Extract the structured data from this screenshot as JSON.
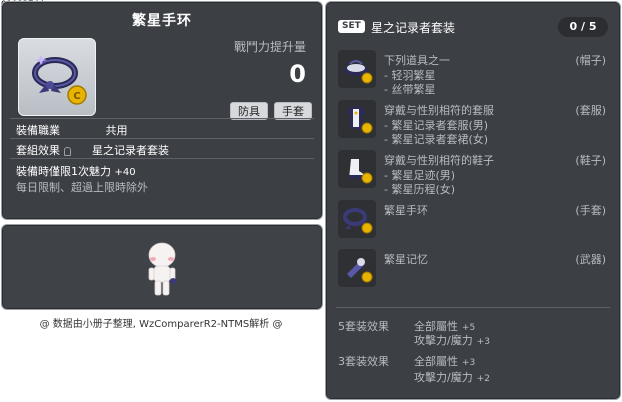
{
  "item_id": "01082744",
  "item": {
    "name": "繁星手环",
    "power_label": "戰鬥力提升量",
    "power_value": "0",
    "tags": [
      "防具",
      "手套"
    ],
    "job_label": "裝備職業",
    "job_value": "共用",
    "set_effect_label": "套組效果",
    "set_effect_value": "星之记录者套装",
    "equip_stat": "裝備時僅限1次魅力",
    "equip_stat_value": "+40",
    "note": "每日限制、超過上限時除外"
  },
  "credit": "@ 数据由小册子整理, WzComparerR2-NTMS解析 @",
  "set": {
    "badge": "SET",
    "name": "星之记录者套装",
    "count": "0 / 5",
    "items": [
      {
        "lines": [
          "下列道具之一",
          "- 轻羽繁星",
          "- 丝带繁星"
        ],
        "category": "(帽子)",
        "icon": "ribbon-hat-icon"
      },
      {
        "lines": [
          "穿戴与性别相符的套服",
          "- 繁星记录者套服(男)",
          "- 繁星记录者套裙(女)"
        ],
        "category": "(套服)",
        "icon": "outfit-icon"
      },
      {
        "lines": [
          "穿戴与性别相符的鞋子",
          "- 繁星足迹(男)",
          "- 繁星历程(女)"
        ],
        "category": "(鞋子)",
        "icon": "shoes-icon"
      },
      {
        "lines": [
          "繁星手环"
        ],
        "category": "(手套)",
        "icon": "bracelet-icon"
      },
      {
        "lines": [
          "繁星记忆"
        ],
        "category": "(武器)",
        "icon": "weapon-icon"
      }
    ],
    "bonuses": [
      {
        "title": "5套装效果",
        "stats": [
          {
            "label": "全部屬性",
            "value": "+5"
          },
          {
            "label": "攻擊力/魔力",
            "value": "+3"
          }
        ]
      },
      {
        "title": "3套装效果",
        "stats": [
          {
            "label": "全部屬性",
            "value": "+3"
          },
          {
            "label": "攻擊力/魔力",
            "value": "+2"
          }
        ]
      }
    ]
  },
  "colors": {
    "panel_bg": "#3c3f44",
    "text": "#ffffff",
    "muted": "#b8bcc2",
    "coin": "#e8b400"
  }
}
